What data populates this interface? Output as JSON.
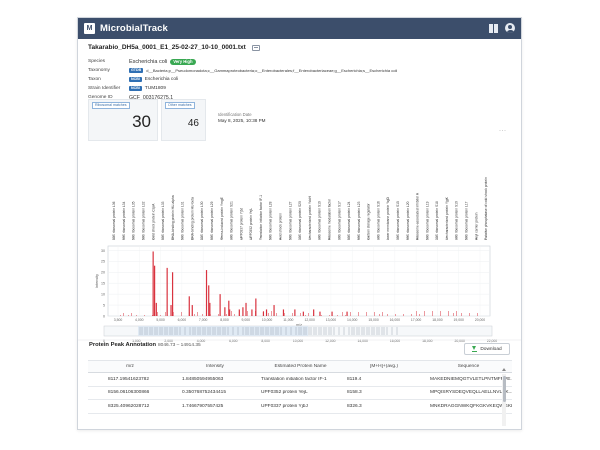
{
  "app": {
    "name": "MicrobialTrack",
    "logo_letter": "M",
    "accent": "#3c4e6b"
  },
  "file": {
    "title": "Takarabio_DH5a_0001_E1_25-02-27_10-10_0001.txt"
  },
  "result": {
    "species_label": "Species",
    "species_value": "Escherichia coli",
    "confidence": "Very High",
    "confidence_color": "#39a852",
    "taxonomy_label": "Taxonomy",
    "taxonomy_source": "GTDB",
    "taxonomy_value": "d__Bacteria;p__Pseudomonadota;c__Gammaproteobacteria;o__Enterobacterales;f__Enterobacteriaceae;g__Escherichia;s__Escherichia coli",
    "taxon_label": "Taxon",
    "taxon_source": "NCBI",
    "taxon_value": "Escherichia coli",
    "strain_label": "Strain Identifier",
    "strain_source": "NCBI",
    "strain_value": "TUM1809",
    "genome_label": "Genome ID",
    "genome_value": "GCF_003176275.1"
  },
  "stats": {
    "ribosomal_label": "Ribosomal matches",
    "ribosomal_value": "30",
    "other_label": "Other matches",
    "other_value": "46",
    "id_date_label": "Identification Date",
    "id_date_value": "May 8, 2025, 10:38 PM"
  },
  "chart_data": {
    "type": "bar",
    "xlabel": "m/z",
    "ylabel": "Intensity",
    "xlim": [
      2000,
      22000
    ],
    "ylim": [
      0,
      32
    ],
    "y_ticks": [
      0,
      5,
      10,
      15,
      20,
      25,
      30
    ],
    "x_ticks": [
      "3,500",
      "4,000",
      "5,000",
      "6,000",
      "7,000",
      "8,000",
      "9,000",
      "10,000",
      "11,000",
      "12,000",
      "13,000",
      "14,000",
      "15,000",
      "16,000",
      "17,000",
      "18,000",
      "19,000",
      "20,000"
    ],
    "overview_ticks": [
      "0",
      "1,000",
      "2,000",
      "4,000",
      "6,000",
      "8,000",
      "10,000",
      "12,000",
      "14,000",
      "16,000",
      "18,000",
      "20,000",
      "22,000"
    ],
    "bar_color": "#d9333f",
    "peaks": [
      {
        "x": 4364,
        "y": 29.5
      },
      {
        "x": 4440,
        "y": 23
      },
      {
        "x": 4530,
        "y": 6
      },
      {
        "x": 5097,
        "y": 22
      },
      {
        "x": 5300,
        "y": 5
      },
      {
        "x": 5381,
        "y": 20
      },
      {
        "x": 6255,
        "y": 9
      },
      {
        "x": 6412,
        "y": 5
      },
      {
        "x": 7158,
        "y": 21
      },
      {
        "x": 7274,
        "y": 14
      },
      {
        "x": 7333,
        "y": 6
      },
      {
        "x": 7870,
        "y": 10
      },
      {
        "x": 8119,
        "y": 4
      },
      {
        "x": 8325,
        "y": 7
      },
      {
        "x": 8369,
        "y": 3
      },
      {
        "x": 8875,
        "y": 3
      },
      {
        "x": 9064,
        "y": 4
      },
      {
        "x": 9226,
        "y": 6
      },
      {
        "x": 9535,
        "y": 3
      },
      {
        "x": 9741,
        "y": 8
      },
      {
        "x": 10138,
        "y": 2
      },
      {
        "x": 10300,
        "y": 3
      },
      {
        "x": 10694,
        "y": 5
      },
      {
        "x": 11186,
        "y": 3
      },
      {
        "x": 11784,
        "y": 3
      },
      {
        "x": 12228,
        "y": 2
      },
      {
        "x": 12768,
        "y": 3
      },
      {
        "x": 13098,
        "y": 2
      },
      {
        "x": 13731,
        "y": 2
      },
      {
        "x": 14516,
        "y": 2
      }
    ],
    "annotations": [
      "50S ribosomal protein L36",
      "50S ribosomal protein L34",
      "50S ribosomal protein L35",
      "50S ribosomal protein L32",
      "Cold shock protein CspA",
      "50S ribosomal protein L33",
      "DNA-binding protein HU-alpha",
      "50S ribosomal protein L31",
      "DNA-binding protein HU-beta",
      "50S ribosomal protein L30",
      "50S ribosomal protein L29",
      "Stress-induced protein YmgE",
      "30S ribosomal protein S21",
      "UPF0337 protein YjbJ",
      "UPF0352 protein YejL",
      "Translation initiation factor IF-1",
      "50S ribosomal protein L28",
      "Acid shock protein",
      "50S ribosomal protein L27",
      "30S ribosomal protein S20",
      "Uncharacterized protein YdcH",
      "30S ribosomal protein S19",
      "Ribosome modulation factor",
      "30S ribosomal protein S17",
      "50S ribosomal protein L24",
      "50S ribosomal protein L23",
      "Carbon storage regulator",
      "30S ribosomal protein S16",
      "Inner membrane protein YqjD",
      "30S ribosomal protein S15",
      "50S ribosomal protein L20",
      "Ribosome-associated inhibitor A",
      "50S ribosomal protein L19",
      "30S ribosomal protein S18",
      "Uncharacterized protein YjgK",
      "30S ribosomal protein S10",
      "50S ribosomal protein L17",
      "Acyl carrier protein",
      "Putative phosphatase of cold shock protein"
    ]
  },
  "annotation_section": {
    "title": "Protein Peak Annotation",
    "range": "8046.73 – 14914.35",
    "download_label": "Download",
    "columns": [
      "m/z",
      "Intensity",
      "Estimated Protein Name",
      "[M+H]+(avg.)",
      "Sequence"
    ],
    "rows": [
      [
        "8117.19541623782",
        "1.84850594955063",
        "Translation initiation factor IF-1",
        "8119.4",
        "MAKEDNIEMQGTVLETLPNTMFRVE..."
      ],
      [
        "8156.06106300866",
        "0.350768752434415",
        "UPF0352 protein YejL",
        "8158.3",
        "MPQISRYSDEQVEQLLAELLNVLEK..."
      ],
      [
        "8325.40962028712",
        "1.74667907557425",
        "UPF0337 protein YjbJ",
        "8326.3",
        "MNKDRAGGNWKQFKGKVKEQWGKL..."
      ]
    ]
  }
}
